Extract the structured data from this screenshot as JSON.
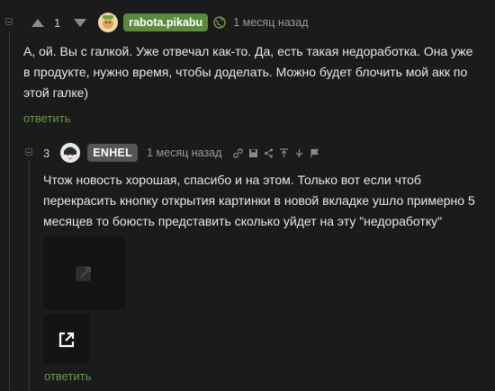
{
  "colors": {
    "background": "#1b1b1b",
    "accent_green": "#5b8a3c",
    "reply_green": "#6a9a4b",
    "muted": "#9a9a9a"
  },
  "comment1": {
    "rating": "1",
    "author": "rabota.pikabu",
    "time": "1 месяц назад",
    "lines": [
      "А, ой. Вы с галкой. Уже отвечал как-то. Да, есть такая недоработка. Она уже",
      "в продукте, нужно время, чтобы доделать. Можно будет блочить мой акк по",
      "этой галке)"
    ],
    "reply_label": "ответить",
    "icons": [
      "upvote-icon",
      "downvote-icon",
      "globe-icon"
    ]
  },
  "comment2": {
    "rating": "3",
    "author": "ENHEL",
    "time": "1 месяц назад",
    "lines": [
      "Чтож новость хорошая, спасибо и на этом. Только вот если чтоб",
      "перекрасить кнопку открытия картинки в новой вкладке ушло примерно 5",
      "месяцев то боюсть представить сколько уйдет на эту \"недоработку\""
    ],
    "reply_label": "ответить",
    "tools": [
      "link-icon",
      "save-icon",
      "share-icon",
      "go-to-parent-icon",
      "filter-icon",
      "report-icon"
    ],
    "images": [
      "image-placeholder-icon",
      "open-in-new-tab-icon"
    ]
  }
}
